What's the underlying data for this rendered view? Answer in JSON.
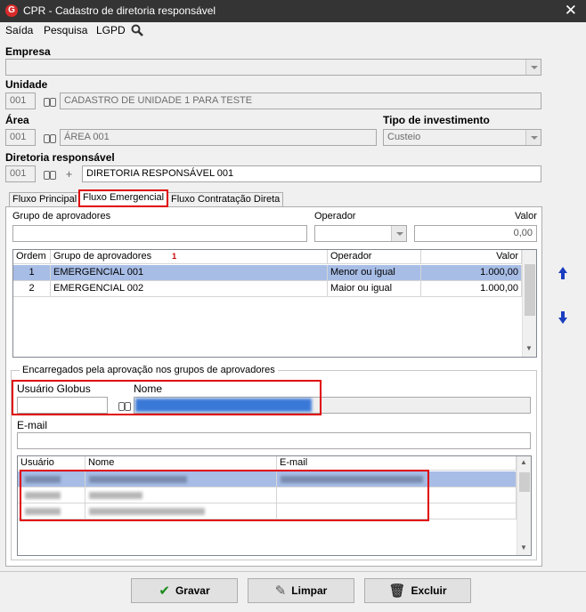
{
  "window": {
    "title": "CPR - Cadastro de diretoria responsável",
    "logo_text": "G",
    "close_glyph": "✕"
  },
  "menu": [
    "Saída",
    "Pesquisa",
    "LGPD"
  ],
  "empresa": {
    "label": "Empresa",
    "value": ""
  },
  "unidade": {
    "label": "Unidade",
    "code": "001",
    "name": "CADASTRO DE UNIDADE 1 PARA TESTE"
  },
  "area": {
    "label": "Área",
    "code": "001",
    "name": "ÁREA 001"
  },
  "tipo_investimento": {
    "label": "Tipo de investimento",
    "value": "Custeio"
  },
  "diretoria": {
    "label": "Diretoria responsável",
    "code": "001",
    "name": "DIRETORIA RESPONSÁVEL 001"
  },
  "tabs": [
    "Fluxo Principal",
    "Fluxo Emergencial",
    "Fluxo Contratação Direta"
  ],
  "filter": {
    "grupo_label": "Grupo de aprovadores",
    "grupo_value": "",
    "operador_label": "Operador",
    "operador_value": "",
    "valor_label": "Valor",
    "valor_value": "0,00"
  },
  "groups_table": {
    "columns": [
      "Ordem",
      "Grupo de aprovadores",
      "Operador",
      "Valor"
    ],
    "sort_indicator": "1",
    "rows": [
      {
        "ordem": "1",
        "grupo": "EMERGENCIAL 001",
        "operador": "Menor ou igual",
        "valor": "1.000,00"
      },
      {
        "ordem": "2",
        "grupo": "EMERGENCIAL 002",
        "operador": "Maior ou igual",
        "valor": "1.000,00"
      }
    ]
  },
  "encarregados": {
    "group_label": "Encarregados pela aprovação nos grupos de aprovadores",
    "usuario_label": "Usuário Globus",
    "usuario_value": "",
    "nome_label": "Nome",
    "nome_value": "",
    "email_label": "E-mail",
    "email_value": ""
  },
  "users_table": {
    "columns": [
      "Usuário",
      "Nome",
      "E-mail"
    ],
    "rows": [
      {
        "usuario": "",
        "nome": "",
        "email": ""
      },
      {
        "usuario": "",
        "nome": "",
        "email": ""
      },
      {
        "usuario": "",
        "nome": "",
        "email": ""
      }
    ]
  },
  "buttons": {
    "gravar": "Gravar",
    "limpar": "Limpar",
    "excluir": "Excluir"
  },
  "colors": {
    "selection": "#a7bde6",
    "highlight": "#e00000",
    "arrow": "#1a3ec0"
  }
}
